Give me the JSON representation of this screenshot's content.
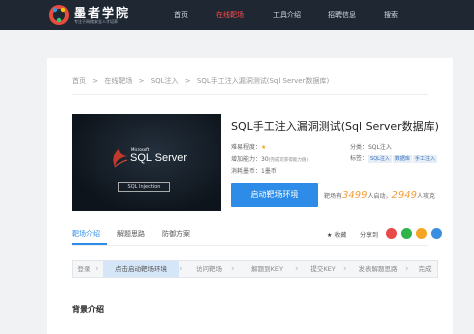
{
  "header": {
    "logo_title": "墨者学院",
    "logo_subtitle": "专注于网络安全人才培养",
    "nav": [
      "首页",
      "在线靶场",
      "工具介绍",
      "招聘信息",
      "搜索"
    ],
    "active_nav": "在线靶场"
  },
  "breadcrumb": [
    "首页",
    ">",
    "在线靶场",
    ">",
    "SQL注入",
    ">",
    "SQL手工注入漏洞测试(Sql Server数据库)"
  ],
  "course": {
    "title": "SQL手工注入漏洞测试(Sql Server数据库)",
    "cover_ms": "Microsoft",
    "cover_title": "SQL Server",
    "cover_tag": "SQL Injection",
    "difficulty_label": "难易程度：",
    "difficulty_stars": "★",
    "bonus_label": "增加能力：30",
    "bonus_note": "(完成可获得能力值)",
    "cost_label": "消耗墨币：1墨币",
    "category_label": "分类：SQL注入",
    "tags_label": "标签：",
    "tags": [
      "SQL注入",
      "数据库",
      "手工注入"
    ]
  },
  "actions": {
    "start_button": "启动靶场环境",
    "stats_prefix": "靶场有",
    "started_count": "3499",
    "started_text": "人启动，",
    "passed_count": "2949",
    "passed_text": "人攻克"
  },
  "tabs": [
    "靶场介绍",
    "解题思路",
    "防御方案"
  ],
  "favorite_label": "收藏",
  "share_label": "分享到",
  "steps": [
    "登录",
    "点击启动靶场环境",
    "访问靶场",
    "解题到KEY",
    "提交KEY",
    "发表解题思路",
    "完成"
  ],
  "current_step": 1,
  "section_title": "背景介绍",
  "colors": {
    "header_bg": "#1f2733",
    "active_nav": "#ff4e4e",
    "accent": "#2d8ce8",
    "stat_number": "#f39c35"
  }
}
